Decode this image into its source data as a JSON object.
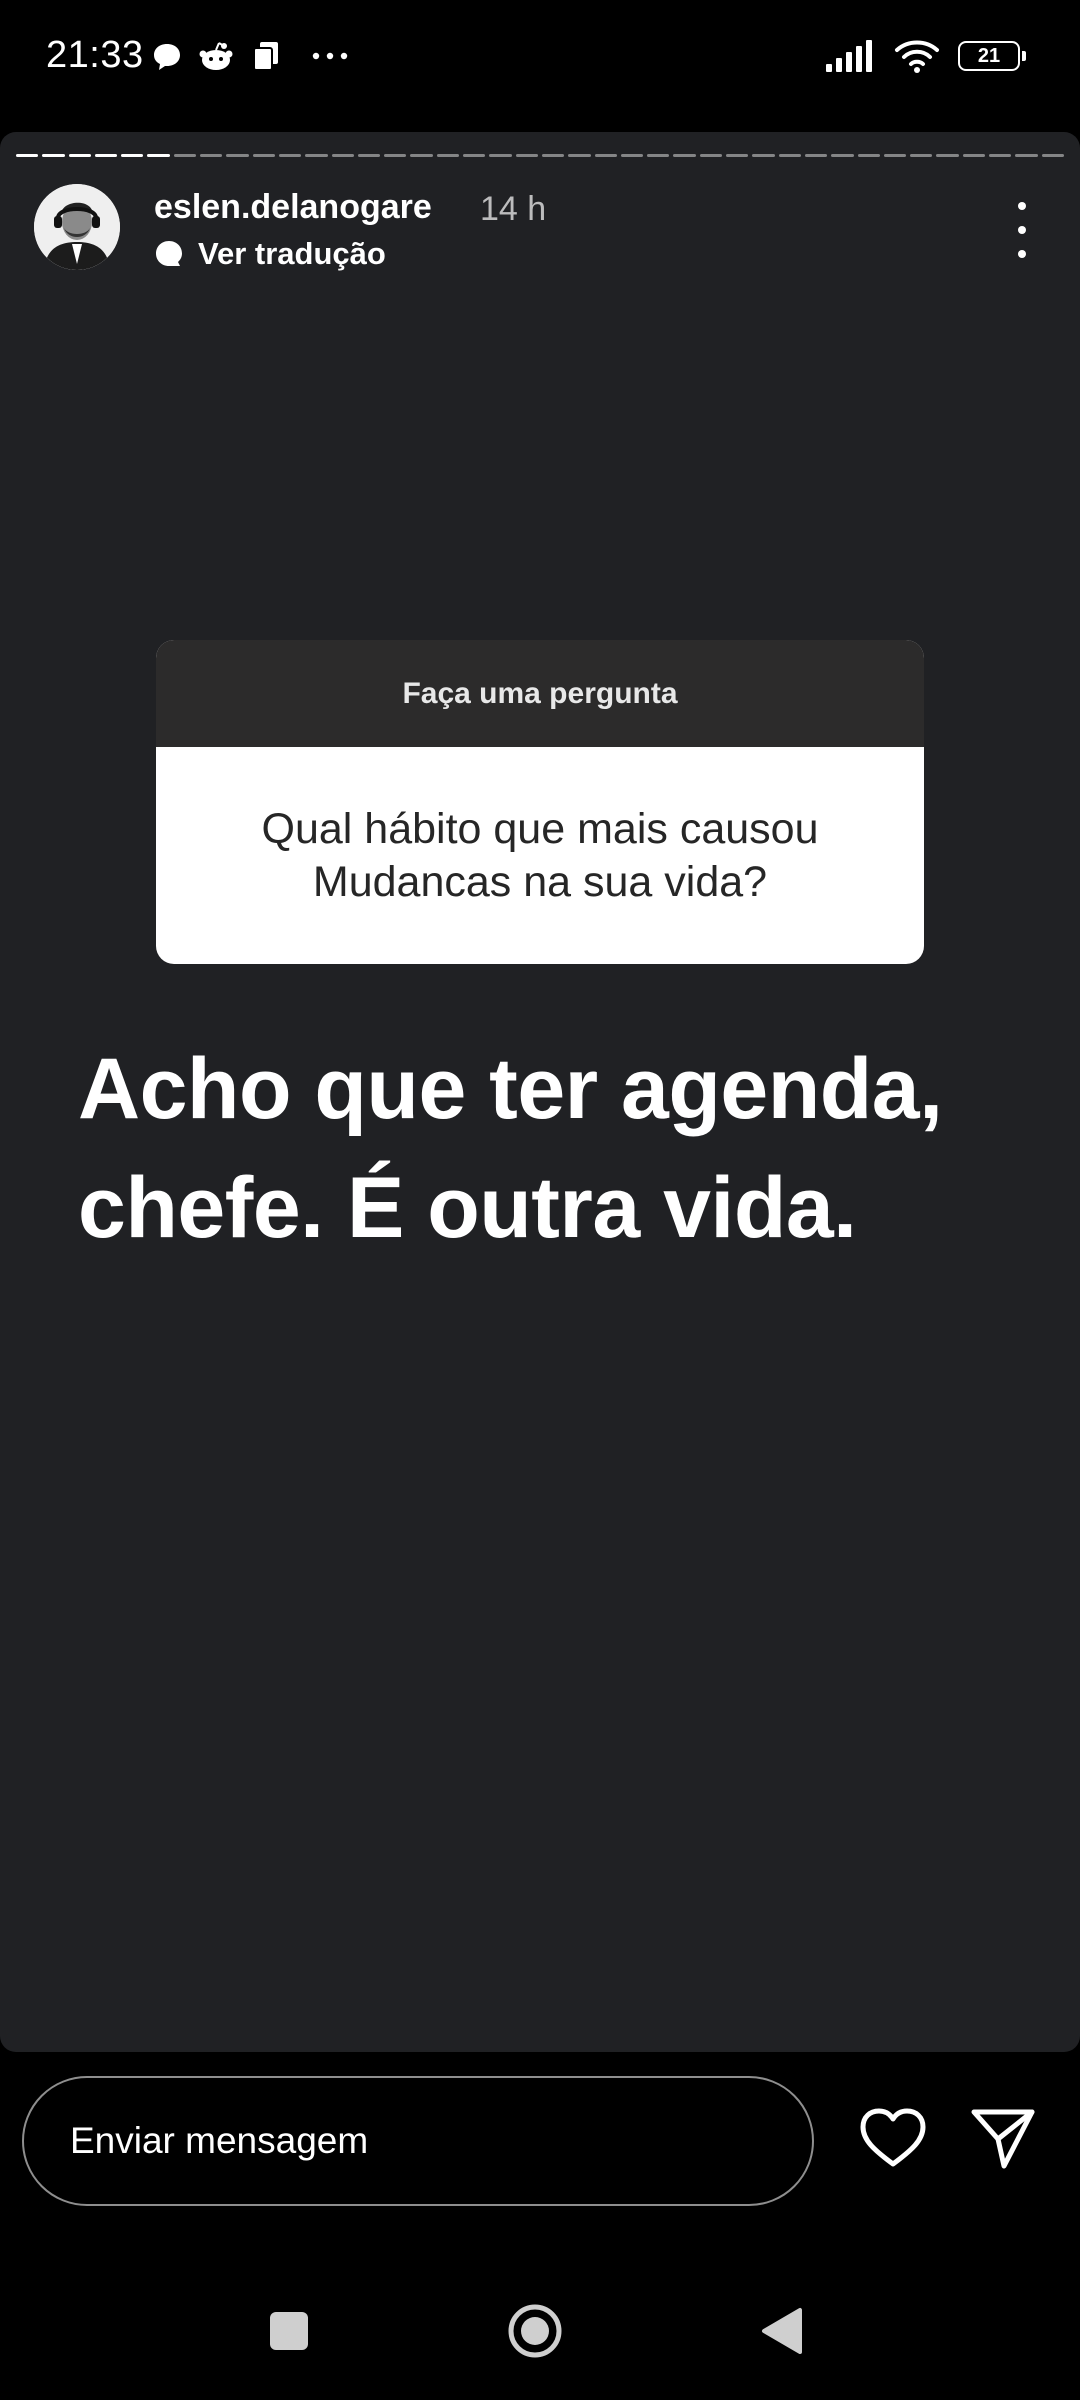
{
  "status_bar": {
    "time": "21:33",
    "notification_icons": [
      "chat-bubble-icon",
      "reddit-icon",
      "files-icon",
      "more-dots-icon"
    ],
    "right_icons": [
      "signal-icon",
      "wifi-icon",
      "battery-icon"
    ],
    "battery": "21"
  },
  "story": {
    "progress": {
      "segments_total": 40,
      "segments_viewed": 6
    },
    "header": {
      "username": "eslen.delanogare",
      "time_ago": "14 h",
      "translate_label": "Ver tradução"
    },
    "question_sticker": {
      "title": "Faça uma pergunta",
      "question": "Qual hábito que mais causou Mudancas na sua vida?"
    },
    "answer_text": "Acho que ter agenda, chefe. É outra vida."
  },
  "reply_bar": {
    "placeholder": "Enviar mensagem"
  },
  "colors": {
    "story_background": "#202124",
    "sticker_header": "#2c2b2b",
    "sticker_body": "#ffffff",
    "text_primary": "#ffffff"
  }
}
